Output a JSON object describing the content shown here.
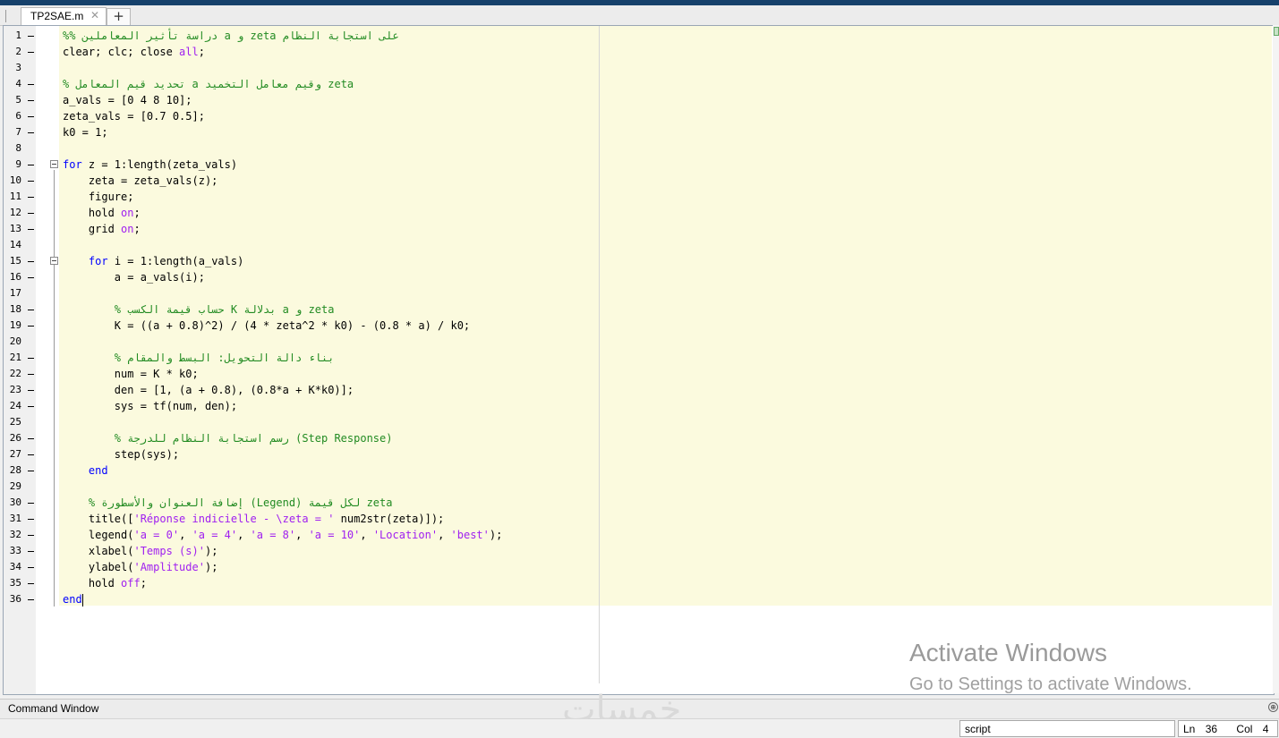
{
  "tabs": [
    {
      "label": "TP2SAE.m",
      "close": "✕"
    }
  ],
  "add_tab": "+",
  "code_lines": [
    [
      {
        "t": "%% دراسة تأثير المعاملين a و zeta على استجابة النظام",
        "c": "cm"
      }
    ],
    [
      {
        "t": "clear; clc; close "
      },
      {
        "t": "all",
        "c": "str"
      },
      {
        "t": ";"
      }
    ],
    [],
    [
      {
        "t": "% تحديد قيم المعامل a وقيم معامل التخميد zeta",
        "c": "cm"
      }
    ],
    [
      {
        "t": "a_vals = [0 4 8 10];"
      }
    ],
    [
      {
        "t": "zeta_vals = [0.7 0.5];"
      }
    ],
    [
      {
        "t": "k0 = 1;"
      }
    ],
    [],
    [
      {
        "t": "for",
        "c": "kw"
      },
      {
        "t": " z = 1:length(zeta_vals)"
      }
    ],
    [
      {
        "t": "    zeta = zeta_vals(z);"
      }
    ],
    [
      {
        "t": "    figure;"
      }
    ],
    [
      {
        "t": "    hold "
      },
      {
        "t": "on",
        "c": "str"
      },
      {
        "t": ";"
      }
    ],
    [
      {
        "t": "    grid "
      },
      {
        "t": "on",
        "c": "str"
      },
      {
        "t": ";"
      }
    ],
    [],
    [
      {
        "t": "    "
      },
      {
        "t": "for",
        "c": "kw"
      },
      {
        "t": " i = 1:length(a_vals)"
      }
    ],
    [
      {
        "t": "        a = a_vals(i);"
      }
    ],
    [],
    [
      {
        "t": "        "
      },
      {
        "t": "% حساب قيمة الكسب K بدلالة a و zeta",
        "c": "cm"
      }
    ],
    [
      {
        "t": "        K = ((a + 0.8)^2) / (4 * zeta^2 * k0) - (0.8 * a) / k0;"
      }
    ],
    [],
    [
      {
        "t": "        "
      },
      {
        "t": "% بناء دالة التحويل: البسط والمقام",
        "c": "cm"
      }
    ],
    [
      {
        "t": "        num = K * k0;"
      }
    ],
    [
      {
        "t": "        den = [1, (a + 0.8), (0.8*a + K*k0)];"
      }
    ],
    [
      {
        "t": "        sys = tf(num, den);"
      }
    ],
    [],
    [
      {
        "t": "        "
      },
      {
        "t": "% رسم استجابة النظام للدرجة (Step Response)",
        "c": "cm"
      }
    ],
    [
      {
        "t": "        step(sys);"
      }
    ],
    [
      {
        "t": "    "
      },
      {
        "t": "end",
        "c": "kw"
      }
    ],
    [],
    [
      {
        "t": "    "
      },
      {
        "t": "% إضافة العنوان والأسطورة (Legend) لكل قيمة zeta",
        "c": "cm"
      }
    ],
    [
      {
        "t": "    title(["
      },
      {
        "t": "'Réponse indicielle - \\zeta = '",
        "c": "str"
      },
      {
        "t": " num2str(zeta)]);"
      }
    ],
    [
      {
        "t": "    legend("
      },
      {
        "t": "'a = 0'",
        "c": "str"
      },
      {
        "t": ", "
      },
      {
        "t": "'a = 4'",
        "c": "str"
      },
      {
        "t": ", "
      },
      {
        "t": "'a = 8'",
        "c": "str"
      },
      {
        "t": ", "
      },
      {
        "t": "'a = 10'",
        "c": "str"
      },
      {
        "t": ", "
      },
      {
        "t": "'Location'",
        "c": "str"
      },
      {
        "t": ", "
      },
      {
        "t": "'best'",
        "c": "str"
      },
      {
        "t": ");"
      }
    ],
    [
      {
        "t": "    xlabel("
      },
      {
        "t": "'Temps (s)'",
        "c": "str"
      },
      {
        "t": ");"
      }
    ],
    [
      {
        "t": "    ylabel("
      },
      {
        "t": "'Amplitude'",
        "c": "str"
      },
      {
        "t": ");"
      }
    ],
    [
      {
        "t": "    hold "
      },
      {
        "t": "off",
        "c": "str"
      },
      {
        "t": ";"
      }
    ],
    [
      {
        "t": "end",
        "c": "kw"
      }
    ]
  ],
  "command_window": {
    "label": "Command Window",
    "expand_icon": "⊕"
  },
  "status": {
    "mode": "script",
    "ln_label": "Ln",
    "ln": "36",
    "col_label": "Col",
    "col": "4"
  },
  "watermark": {
    "line1": "Activate Windows",
    "line2": "Go to Settings to activate Windows."
  },
  "logo_text": "خمسات"
}
